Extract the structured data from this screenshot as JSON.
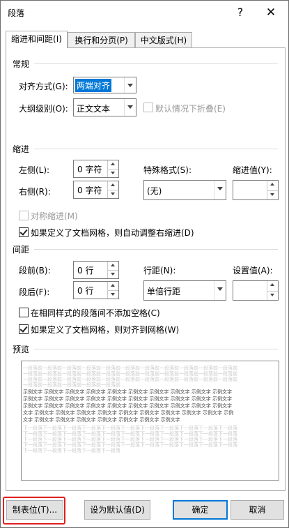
{
  "window": {
    "title": "段落",
    "help": "?",
    "close": "✕"
  },
  "tabs": [
    {
      "label": "缩进和间距(I)"
    },
    {
      "label": "换行和分页(P)"
    },
    {
      "label": "中文版式(H)"
    }
  ],
  "general": {
    "group": "常规",
    "alignment_label": "对齐方式(G):",
    "alignment_value": "两端对齐",
    "outline_label": "大纲级别(O):",
    "outline_value": "正文文本",
    "collapse_label": "默认情况下折叠(E)"
  },
  "indent": {
    "group": "缩进",
    "left_label": "左侧(L):",
    "left_value": "0 字符",
    "right_label": "右侧(R):",
    "right_value": "0 字符",
    "special_label": "特殊格式(S):",
    "special_value": "(无)",
    "amount_label": "缩进值(Y):",
    "amount_value": "",
    "mirror_label": "对称缩进(M)",
    "auto_adjust_label": "如果定义了文档网格，则自动调整右缩进(D)"
  },
  "spacing": {
    "group": "间距",
    "before_label": "段前(B):",
    "before_value": "0 行",
    "after_label": "段后(F):",
    "after_value": "0 行",
    "line_label": "行距(N):",
    "line_value": "单倍行距",
    "at_label": "设置值(A):",
    "at_value": "",
    "no_space_label": "在相同样式的段落间不添加空格(C)",
    "snap_grid_label": "如果定义了文档网格，则对齐到网格(W)"
  },
  "preview": {
    "group": "预览",
    "lines": [
      {
        "text": "一段落前一段落前一段落前一段落前一段落前一段落前一段落前一段落前一段落前一段落前一段落前",
        "tone": "gray"
      },
      {
        "text": "一段落前一段落前一段落前一段落前一段落前一段落前一段落前一段落前一段落前一段落前一段落前",
        "tone": "gray"
      },
      {
        "text": "一段落前一段落前一段落前一段落前一段落前一段落前一段落前一段落前一段落前一段落前一段落前",
        "tone": "gray"
      },
      {
        "text": "一段落前一段落前一段落前一段落前一段落前",
        "tone": "gray"
      },
      {
        "text": "示例文字  示例文字  示例文字  示例文字  示例文字  示例文字  示例文字  示例文字  示例文字  示例文字",
        "tone": "dark"
      },
      {
        "text": "示例文字  示例文字  示例文字  示例文字  示例文字  示例文字  示例文字  示例文字  示例文字  示例文字",
        "tone": "dark"
      },
      {
        "text": "示例文字  示例文字  示例文字  示例文字  示例文字  示例文字  示例文字  示例文字  示例文字  示例文字",
        "tone": "dark"
      },
      {
        "text": "文字  示例文字  示例文字  示例文字  示例文字  示例文字  示例文字  示例文字  示例文字  示例文字  示例",
        "tone": "dark"
      },
      {
        "text": "文字  示例文字  示例文字  示例文字  示例文字  示例文字  示例文字  示例文字",
        "tone": "dark"
      },
      {
        "text": "下一段落下一段落下一段落下一段落下一段落下一段落下一段落下一段落下一段落下一段落下一段落",
        "tone": "gray"
      },
      {
        "text": "下一段落下一段落下一段落下一段落下一段落下一段落下一段落下一段落下一段落下一段落下一段落",
        "tone": "gray"
      },
      {
        "text": "下一段落下一段落下一段落下一段落下一段落下一段落下一段落下一段落下一段落下一段落下一段落",
        "tone": "gray"
      },
      {
        "text": "下一段落下一段落下一段落下一段落下一段落下一段落下一段落下一段落下一段落下一段落下一段落",
        "tone": "gray"
      },
      {
        "text": "下一段落下一段落下一段落下一段落下一段落",
        "tone": "gray"
      }
    ]
  },
  "buttons": {
    "tabs": "制表位(T)...",
    "set_default": "设为默认值(D)",
    "ok": "确定",
    "cancel": "取消"
  }
}
